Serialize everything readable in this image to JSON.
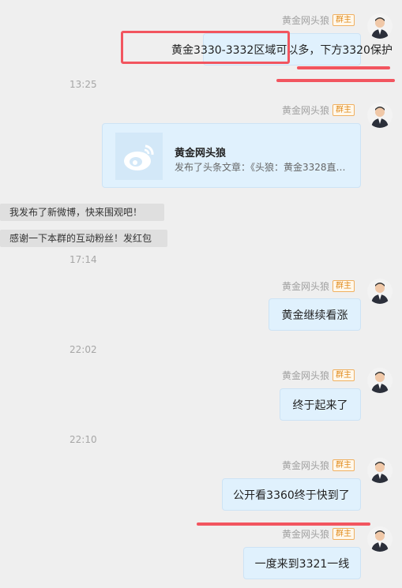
{
  "sender": {
    "name": "黄金网头狼",
    "badge": "群主"
  },
  "messages": [
    {
      "text": "黄金3330-3332区域可以多，下方3320保护"
    },
    {
      "card_title": "黄金网头狼",
      "card_desc": "发布了头条文章：《头狼：黄金3328直…"
    },
    {
      "text": "黄金继续看涨"
    },
    {
      "text": "终于起来了"
    },
    {
      "text": "公开看3360终于快到了"
    },
    {
      "text": "一度来到3321一线"
    }
  ],
  "left_notices": [
    "我发布了新微博，快来围观吧！",
    "感谢一下本群的互动粉丝！发红包"
  ],
  "times": [
    "13:25",
    "17:14",
    "22:02",
    "22:10"
  ]
}
